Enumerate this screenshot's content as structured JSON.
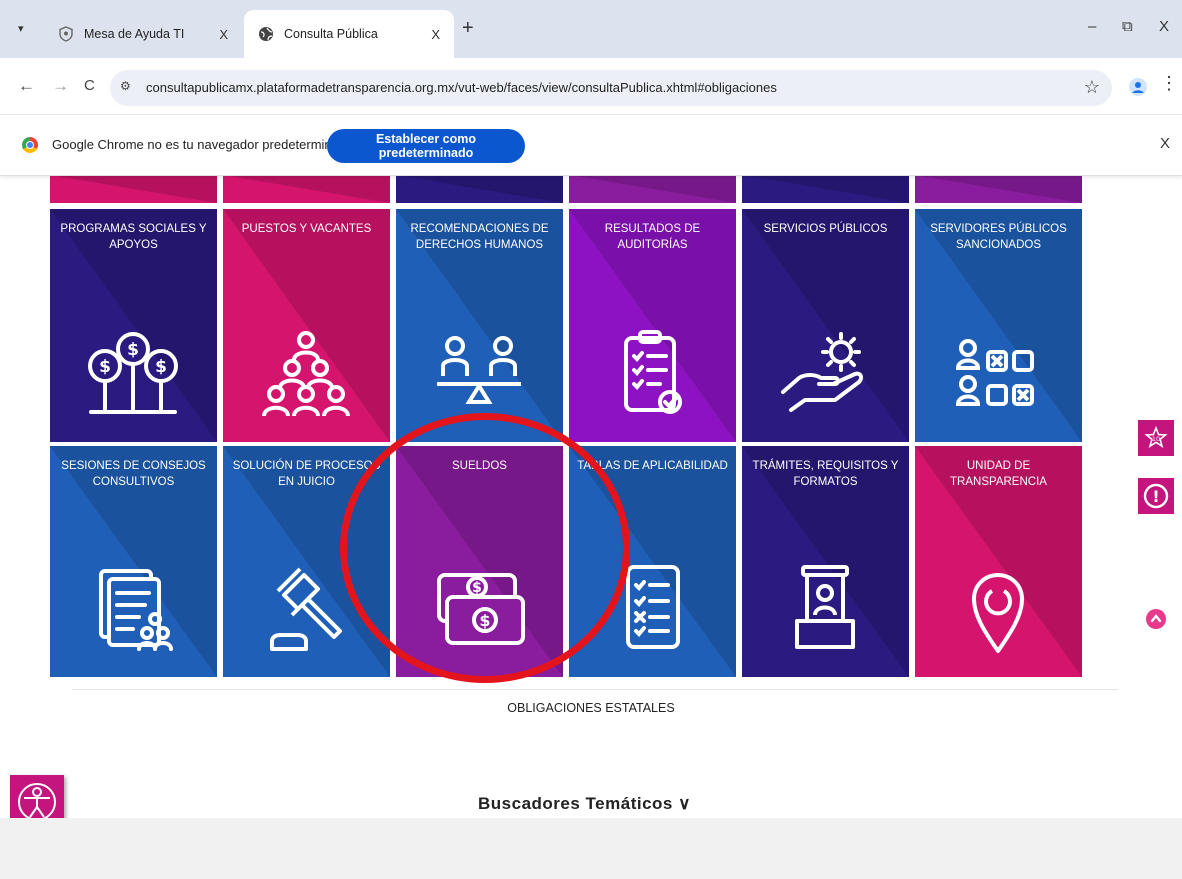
{
  "browser": {
    "tabs": [
      {
        "title": "Mesa de Ayuda TI",
        "active": false
      },
      {
        "title": "Consulta Pública",
        "active": true
      }
    ],
    "new_tab": "+",
    "window_controls": {
      "minimize": "–",
      "restore": "⧉",
      "close": "X"
    },
    "nav": {
      "back": "←",
      "forward": "→",
      "reload": "C"
    },
    "url": "consultapublicamx.plataformadetransparencia.org.mx/vut-web/faces/view/consultaPublica.xhtml#obligaciones",
    "bookmark_star": "☆",
    "menu": "⋮"
  },
  "infobar": {
    "message": "Google Chrome no es tu navegador predeterminado",
    "button": "Establecer como predeterminado",
    "close": "X"
  },
  "grid": {
    "rows": [
      [
        {
          "label": "PROGRAMAS SOCIALES Y APOYOS",
          "icon": "money-tree-icon",
          "color": "#2b1a7f"
        },
        {
          "label": "PUESTOS Y VACANTES",
          "icon": "people-group-icon",
          "color": "#d4146d"
        },
        {
          "label": "RECOMENDACIONES DE DERECHOS HUMANOS",
          "icon": "balance-people-icon",
          "color": "#1f5fb7"
        },
        {
          "label": "RESULTADOS DE AUDITORÍAS",
          "icon": "clipboard-check-icon",
          "color": "#8d13c2"
        },
        {
          "label": "SERVICIOS PÚBLICOS",
          "icon": "hand-gear-icon",
          "color": "#2b1a7f"
        },
        {
          "label": "SERVIDORES PÚBLICOS SANCIONADOS",
          "icon": "sanctioned-people-icon",
          "color": "#1f5fb7"
        }
      ],
      [
        {
          "label": "SESIONES DE CONSEJOS CONSULTIVOS",
          "icon": "documents-people-icon",
          "color": "#1f5fb7"
        },
        {
          "label": "SOLUCIÓN DE PROCESOS EN JUICIO",
          "icon": "gavel-icon",
          "color": "#1f5fb7"
        },
        {
          "label": "SUELDOS",
          "icon": "banknotes-icon",
          "color": "#8a1c9e"
        },
        {
          "label": "TABLAS DE APLICABILIDAD",
          "icon": "checklist-icon",
          "color": "#1f5fb7"
        },
        {
          "label": "TRÁMITES, REQUISITOS Y FORMATOS",
          "icon": "service-window-icon",
          "color": "#2b1a7f"
        },
        {
          "label": "UNIDAD DE TRANSPARENCIA",
          "icon": "location-pin-icon",
          "color": "#d4146d"
        }
      ]
    ]
  },
  "section_title": "OBLIGACIONES ESTATALES",
  "buscadores": "Buscadores Temáticos ∨",
  "side_buttons": {
    "top": "10",
    "alert": "!"
  }
}
